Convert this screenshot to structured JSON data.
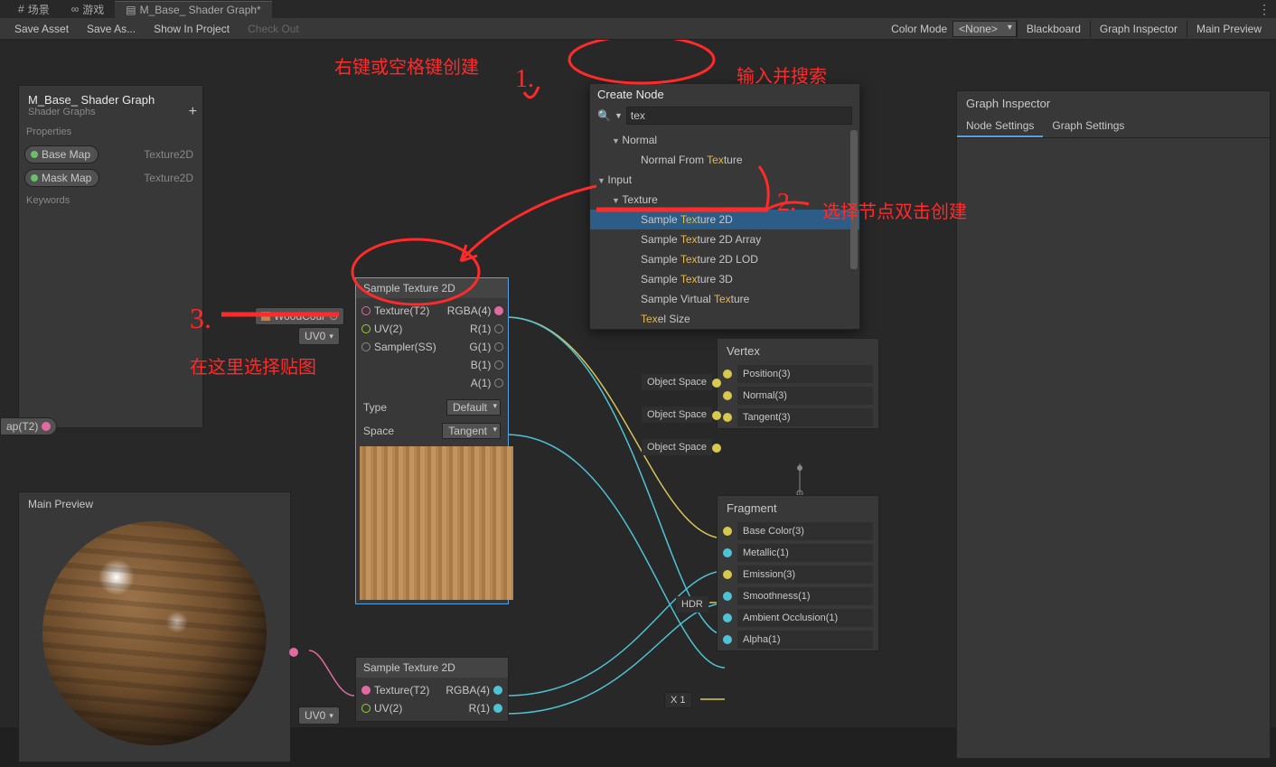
{
  "tabs": {
    "scene": "场景",
    "game": "游戏",
    "graph": "M_Base_ Shader Graph*"
  },
  "toolbar": {
    "save": "Save Asset",
    "saveAs": "Save As...",
    "showInProject": "Show In Project",
    "checkOut": "Check Out",
    "colorMode": "Color Mode",
    "colorModeVal": "<None>",
    "blackboard": "Blackboard",
    "graphInspector": "Graph Inspector",
    "mainPreview": "Main Preview"
  },
  "blackboard": {
    "title": "M_Base_ Shader Graph",
    "sub": "Shader Graphs",
    "propsLabel": "Properties",
    "keywordsLabel": "Keywords",
    "props": [
      {
        "name": "Base Map",
        "type": "Texture2D",
        "color": "#6bbf6b"
      },
      {
        "name": "Mask Map",
        "type": "Texture2D",
        "color": "#6bbf6b"
      }
    ]
  },
  "preview": {
    "title": "Main Preview"
  },
  "createPopup": {
    "title": "Create Node",
    "search": "tex",
    "placeholder": "",
    "cat_normal": "Normal",
    "item_normal_from": "Normal From Texture",
    "cat_input": "Input",
    "cat_texture": "Texture",
    "items": [
      "Sample Texture 2D",
      "Sample Texture 2D Array",
      "Sample Texture 2D LOD",
      "Sample Texture 3D",
      "Sample Virtual Texture",
      "Texel Size"
    ]
  },
  "sampleNode": {
    "title": "Sample Texture 2D",
    "in": [
      "Texture(T2)",
      "UV(2)",
      "Sampler(SS)"
    ],
    "out": [
      "RGBA(4)",
      "R(1)",
      "G(1)",
      "B(1)",
      "A(1)"
    ],
    "typeLabel": "Type",
    "typeVal": "Default",
    "spaceLabel": "Space",
    "spaceVal": "Tangent",
    "texPill": "WoodCour",
    "uvPill": "UV0"
  },
  "sampleNode2": {
    "title": "Sample Texture 2D",
    "in": [
      "Texture(T2)",
      "UV(2)"
    ],
    "out": [
      "RGBA(4)",
      "R(1)"
    ],
    "uvPill": "UV0"
  },
  "clip": {
    "label": "ap(T2)"
  },
  "vertex": {
    "title": "Vertex",
    "rows": [
      {
        "space": "Object Space",
        "name": "Position(3)"
      },
      {
        "space": "Object Space",
        "name": "Normal(3)"
      },
      {
        "space": "Object Space",
        "name": "Tangent(3)"
      }
    ]
  },
  "fragment": {
    "title": "Fragment",
    "rows": [
      {
        "name": "Base Color(3)"
      },
      {
        "name": "Metallic(1)"
      },
      {
        "name": "Emission(3)",
        "badge": "HDR"
      },
      {
        "name": "Smoothness(1)"
      },
      {
        "name": "Ambient Occlusion(1)"
      },
      {
        "name": "Alpha(1)",
        "num": "X 1"
      }
    ]
  },
  "inspector": {
    "title": "Graph Inspector",
    "tab1": "Node Settings",
    "tab2": "Graph Settings"
  },
  "anno": {
    "a1": "右键或空格键创建",
    "a1n": "1.",
    "a2": "输入并搜索",
    "a3": "选择节点双击创建",
    "a3n": "2.",
    "a4": "3.",
    "a5": "在这里选择贴图"
  }
}
